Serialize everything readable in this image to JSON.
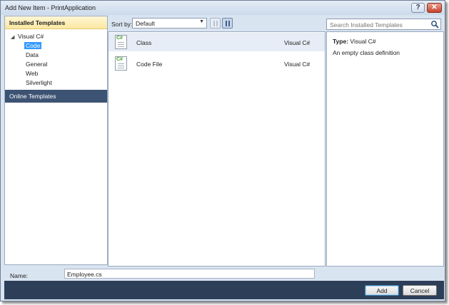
{
  "window": {
    "title": "Add New Item - PrintApplication",
    "help_label": "?",
    "close_label": "✕"
  },
  "left_panel": {
    "header": "Installed Templates",
    "root": {
      "label": "Visual C#",
      "expander": "◢"
    },
    "items": [
      {
        "label": "Code",
        "selected": true
      },
      {
        "label": "Data",
        "selected": false
      },
      {
        "label": "General",
        "selected": false
      },
      {
        "label": "Web",
        "selected": false
      },
      {
        "label": "Silverlight",
        "selected": false
      }
    ],
    "online_templates": "Online Templates"
  },
  "sort_bar": {
    "label": "Sort by:",
    "selected": "Default",
    "arrow": "▼"
  },
  "templates": [
    {
      "name": "Class",
      "language": "Visual C#",
      "icon": "csharp-file-icon",
      "selected": true
    },
    {
      "name": "Code File",
      "language": "Visual C#",
      "icon": "csharp-file-icon",
      "selected": false
    }
  ],
  "search": {
    "placeholder": "Search Installed Templates"
  },
  "details": {
    "type_label": "Type:",
    "type_value": "Visual C#",
    "description": "An empty class definition"
  },
  "name_field": {
    "label": "Name:",
    "value": "Employee.cs"
  },
  "buttons": {
    "add": "Add",
    "cancel": "Cancel"
  },
  "colors": {
    "chrome": "#d9e4f1",
    "header_highlight": "#fce8a2",
    "online_bar": "#3d5373",
    "footer": "#2c3e58",
    "selection": "#3399ff"
  }
}
